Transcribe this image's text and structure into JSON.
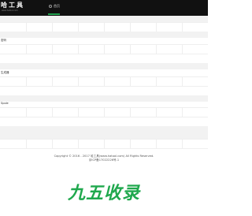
{
  "header": {
    "logo_text": "哈工具",
    "logo_subtext": "www.hatool.com",
    "nav": [
      {
        "label": "首页",
        "icon": "home-icon"
      }
    ],
    "accent_color": "#21a04e"
  },
  "sections": [
    {
      "title": ""
    },
    {
      "title": "密码"
    },
    {
      "title": "生成器"
    },
    {
      "title": "Spole"
    }
  ],
  "footer": {
    "copyright": "Copyright © 2016 - 2017 哈工具(www.hatool.com) All Rights Reserved.",
    "icp": "京ICP备17022226号-1",
    "watermark": "九五收录"
  }
}
